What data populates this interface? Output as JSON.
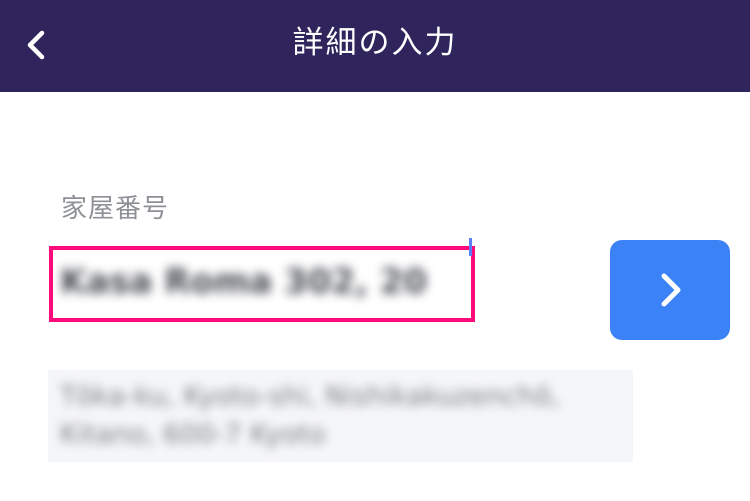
{
  "colors": {
    "header_bg": "#2f255c",
    "accent": "#3b82f6",
    "highlight": "#ff0a7a"
  },
  "header": {
    "title": "詳細の入力",
    "back_icon": "chevron-left-icon"
  },
  "form": {
    "field_label": "家屋番号",
    "field_value": "Kasa Roma 302, 20",
    "next_icon": "chevron-right-icon"
  },
  "address": {
    "text": "Tōka-ku, Kyoto-shi, Nishikakuzenchō, Kitano, 600-7 Kyoto"
  }
}
